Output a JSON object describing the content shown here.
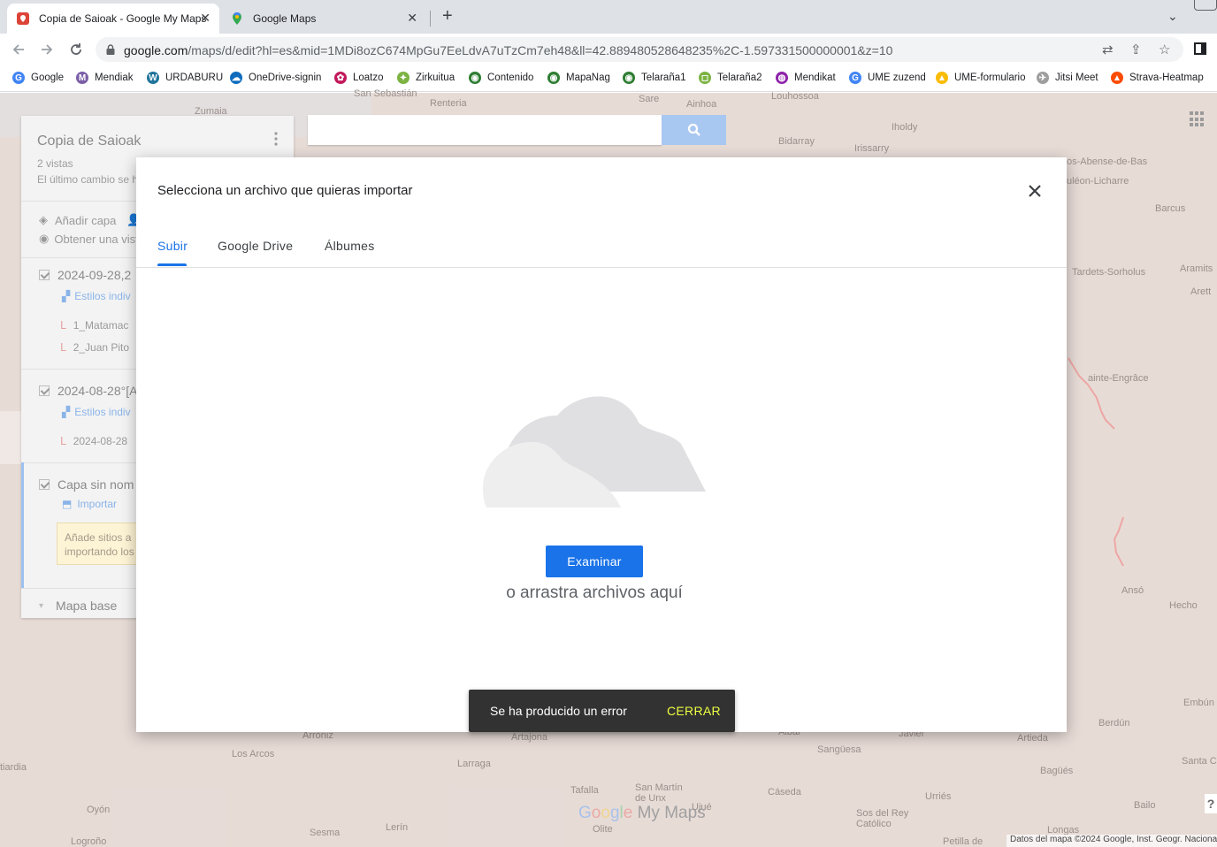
{
  "browser": {
    "tabs": [
      {
        "title": "Copia de Saioak - Google My Maps"
      },
      {
        "title": "Google Maps"
      }
    ],
    "new_tab": "+",
    "url_host": "google.com",
    "url_path": "/maps/d/edit?hl=es&mid=1MDi8ozC674MpGu7EeLdvA7uTzCm7eh48&ll=42.889480528648235%2C-1.597331500000001&z=10",
    "bookmarks": [
      {
        "label": "Google",
        "color": "#4285f4",
        "glyph": "G"
      },
      {
        "label": "Mendiak",
        "color": "#7b5ea7",
        "glyph": "M"
      },
      {
        "label": "URDABURU",
        "color": "#21759b",
        "glyph": "W"
      },
      {
        "label": "OneDrive-signin",
        "color": "#0f6cbd",
        "glyph": "☁"
      },
      {
        "label": "Loatzo",
        "color": "#c2185b",
        "glyph": "✿"
      },
      {
        "label": "Zirkuitua",
        "color": "#7cb342",
        "glyph": "✦"
      },
      {
        "label": "Contenido",
        "color": "#2e7d32",
        "glyph": "◉"
      },
      {
        "label": "MapaNag",
        "color": "#2e7d32",
        "glyph": "◉"
      },
      {
        "label": "Telaraña1",
        "color": "#2e7d32",
        "glyph": "◉"
      },
      {
        "label": "Telaraña2",
        "color": "#7cb342",
        "glyph": "◻"
      },
      {
        "label": "Mendikat",
        "color": "#8e24aa",
        "glyph": "◍"
      },
      {
        "label": "UME zuzend",
        "color": "#4285f4",
        "glyph": "G"
      },
      {
        "label": "UME-formulario",
        "color": "#fbbc04",
        "glyph": "▲"
      },
      {
        "label": "Jitsi Meet",
        "color": "#9e9e9e",
        "glyph": "✈"
      },
      {
        "label": "Strava-Heatmap",
        "color": "#fc4c02",
        "glyph": "▲"
      }
    ]
  },
  "map": {
    "panel": {
      "title": "Copia de Saioak",
      "views": "2 vistas",
      "last_change": "El último cambio se h",
      "add_layer": "Añadir capa",
      "share": "Obtener una vista",
      "layers": [
        {
          "name": "2024-09-28,2",
          "styles": "Estilos indiv",
          "items": [
            "1_Matamac",
            "2_Juan Pito"
          ]
        },
        {
          "name": "2024-08-28°[A",
          "styles": "Estilos indiv",
          "items": [
            "2024-08-28"
          ]
        },
        {
          "name": "Capa sin nom",
          "import": "Importar",
          "tip": "Añade sitios a importando los"
        }
      ],
      "base_map": "Mapa base"
    },
    "labels": {
      "renteria": "Renteria",
      "sare": "Sare",
      "ainhoa": "Ainhoa",
      "louhossoa": "Louhossoa",
      "zumaia": "Zumaia",
      "bidarray": "Bidarray",
      "irissarry": "Irissarry",
      "iholdy": "Iholdy",
      "sanseb": "San Sebastián",
      "abense": "os-Abense-de-Bas",
      "licharre": "uléon-Licharre",
      "barcus": "Barcus",
      "tardets": "Tardets-Sorholus",
      "aramits": "Aramits",
      "arette": "Arett",
      "engrace": "ainte-Engrâce",
      "anso": "Ansó",
      "hecho": "Hecho",
      "embun": "Embún",
      "berdun": "Berdún",
      "santa": "Santa C",
      "bagues": "Bagüés",
      "urries": "Urriés",
      "bailo": "Bailo",
      "longas": "Longas",
      "sos": "Sos del Rey Católico",
      "caseda": "Cáseda",
      "sanguesa": "Sangüesa",
      "artieda": "Artieda",
      "javier": "Javier",
      "aibar": "Aibar",
      "artajona": "Artajona",
      "arroniz": "Arróniz",
      "losarcos": "Los Arcos",
      "larraga": "Larraga",
      "tafalla": "Tafalla",
      "sanmartin": "San Martín de Unx",
      "ujue": "Ujué",
      "olite": "Olite",
      "oyon": "Oyón",
      "lerin": "Lerín",
      "sesma": "Sesma",
      "logrono": "Logroño",
      "tiardia": "tiardia",
      "petilla": "Petilla de"
    }
  },
  "dialog": {
    "title": "Selecciona un archivo que quieras importar",
    "tabs": [
      "Subir",
      "Google Drive",
      "Álbumes"
    ],
    "browse_label": "Examinar",
    "drop_hint": "o arrastra archivos aquí"
  },
  "snackbar": {
    "message": "Se ha producido un error",
    "action": "CERRAR"
  },
  "footer": {
    "brand_google": [
      "G",
      "o",
      "o",
      "g",
      "l",
      "e"
    ],
    "brand_product": "My Maps",
    "attribution": "Datos del mapa ©2024 Google, Inst. Geogr. Nacional",
    "help": "?"
  },
  "colors": {
    "accent": "#1a73e8",
    "snackbar_action": "#eeff41"
  }
}
